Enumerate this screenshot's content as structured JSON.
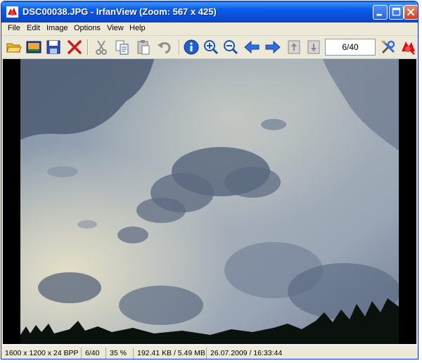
{
  "window": {
    "title": "DSC00038.JPG - IrfanView (Zoom: 567 x 425)"
  },
  "menu": {
    "file": "File",
    "edit": "Edit",
    "image": "Image",
    "options": "Options",
    "view": "View",
    "help": "Help"
  },
  "toolbar": {
    "page_counter": "6/40",
    "icons": [
      "open-folder-icon",
      "thumbnails-icon",
      "save-icon",
      "delete-icon",
      "cut-icon",
      "copy-icon",
      "paste-icon",
      "undo-icon",
      "info-icon",
      "zoom-in-icon",
      "zoom-out-icon",
      "previous-arrow-icon",
      "next-arrow-icon",
      "first-page-icon",
      "last-page-icon",
      "properties-tools-icon",
      "exit-icon"
    ]
  },
  "status": {
    "dimensions": "1600 x 1200 x 24 BPP",
    "index": "6/40",
    "zoom": "35 %",
    "size": "192.41 KB / 5.49 MB",
    "datetime": "26.07.2009 / 16:33:44"
  },
  "colors": {
    "titlebar": "#0a5ce8",
    "chrome": "#ece9d8",
    "close_button": "#d2401a"
  }
}
